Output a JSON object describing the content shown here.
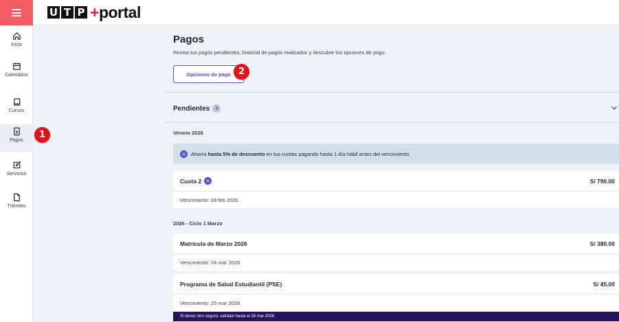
{
  "topbar": {
    "logo_letters": [
      "U",
      "T",
      "P"
    ],
    "logo_plus": "+",
    "logo_word": "portal"
  },
  "sidebar": {
    "items": [
      {
        "label": "Inicio",
        "icon": "home-icon"
      },
      {
        "label": "Calendario",
        "icon": "calendar-icon"
      },
      {
        "label": "Cursos",
        "icon": "book-icon"
      },
      {
        "label": "Pagos",
        "icon": "payment-icon",
        "active": true
      },
      {
        "label": "Servicios",
        "icon": "edit-icon"
      },
      {
        "label": "Trámites",
        "icon": "document-icon"
      }
    ]
  },
  "page": {
    "title": "Pagos",
    "subtitle": "Revisa tus pagos pendientes, historial de pagos realizados y descubre tus opciones de pago.",
    "options_button": "Opciones de pago"
  },
  "pending": {
    "title": "Pendientes",
    "count": "3",
    "groups": [
      {
        "title": "Verano 2026",
        "promo": {
          "pre": "Ahorra ",
          "bold": "hasta 5% de descuento",
          "post": " en tus cuotas pagando hasta 1 día hábil antes del vencimiento."
        },
        "items": [
          {
            "name": "Cuota 2",
            "amount": "S/ 790.00",
            "due": "Vencimiento: 09 feb 2026",
            "discount_badge": true
          }
        ]
      },
      {
        "title": "2026 - Ciclo 1 Marzo",
        "items": [
          {
            "name": "Matrícula de Marzo 2026",
            "amount": "S/ 380.00",
            "due": "Vencimiento: 24 mar 2026"
          },
          {
            "name": "Programa de Salud Estudiantil (PSE)",
            "amount": "S/ 45.00",
            "due": "Vencimiento: 25 mar 2026",
            "note": "Si tienes otro seguro, valídalo hasta el 28 mar 2026"
          }
        ]
      }
    ]
  },
  "annotations": {
    "marker_1": "1",
    "marker_2": "2"
  },
  "colors": {
    "accent": "#5b4bd4",
    "brand_red": "#f25a64",
    "marker_red": "#e0131a",
    "note_bg": "#23135a",
    "promo_bg": "#d3e0ec"
  }
}
